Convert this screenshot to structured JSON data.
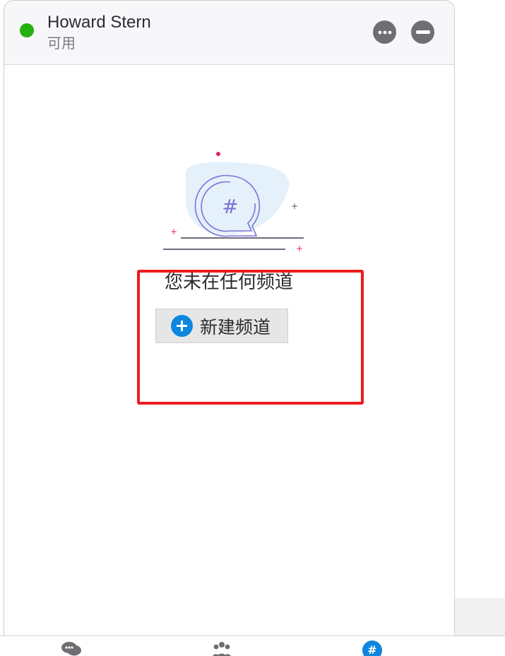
{
  "header": {
    "user_name": "Howard Stern",
    "status_text": "可用",
    "status_color": "#26b010",
    "more_icon": "more-icon",
    "minimize_icon": "minimize-icon"
  },
  "main": {
    "illustration_icon": "hashtag-chat-bubble-icon",
    "illustration_hash": "#",
    "empty_message": "您未在任何频道",
    "new_channel_label": "新建频道",
    "new_channel_icon": "plus-circle-icon",
    "accent_color": "#0d86de"
  },
  "bottom_nav": {
    "items": [
      {
        "icon": "chat-icon",
        "active": false
      },
      {
        "icon": "contacts-icon",
        "active": false
      },
      {
        "icon": "channels-icon",
        "label": "#",
        "active": true
      }
    ]
  },
  "annotation": {
    "highlight_color": "#ee1c1c"
  }
}
